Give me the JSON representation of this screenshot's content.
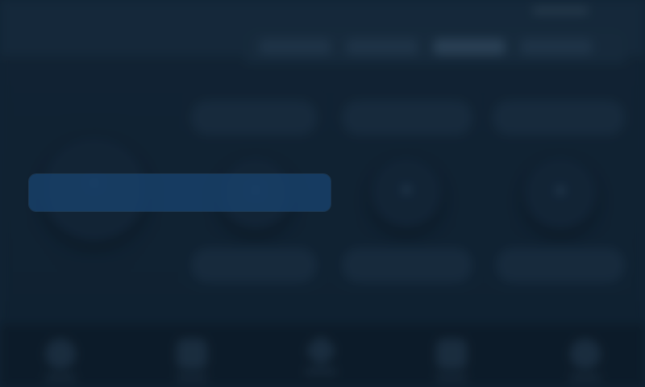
{
  "overlay": {
    "focus_bar_color": "#18426e",
    "dim_color": "#0a1623"
  },
  "blurred_ui": {
    "tab_count": 4,
    "knob_count": 4,
    "pill_count": 6,
    "nav_count": 5
  }
}
